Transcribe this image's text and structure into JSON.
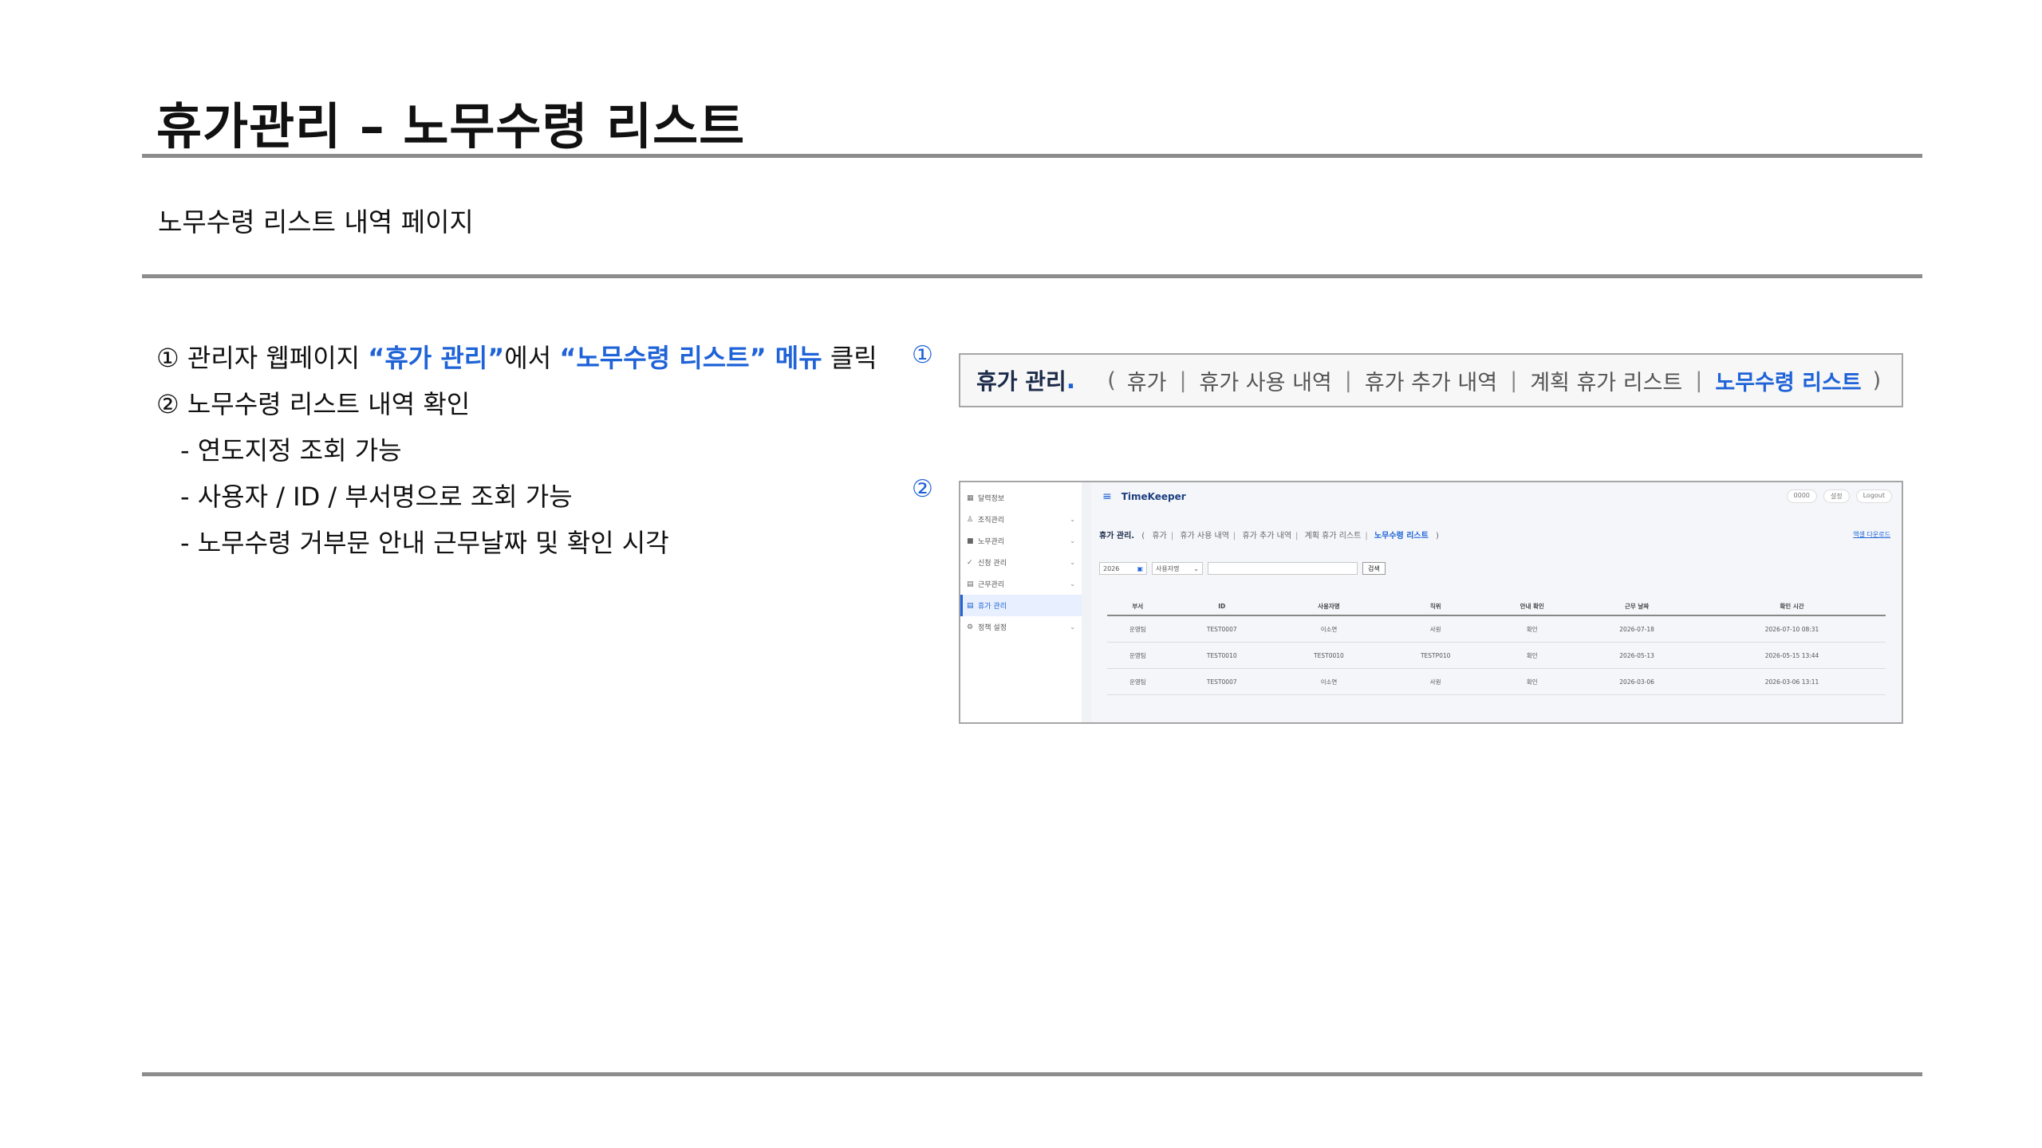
{
  "header": {
    "title": "휴가관리 – 노무수령 리스트",
    "subtitle": "노무수령 리스트 내역 페이지"
  },
  "steps": {
    "step1": {
      "num": "①",
      "pre": "관리자 웹페이지 ",
      "hl1": "“휴가 관리”",
      "mid": "에서 ",
      "hl2": "“노무수령 리스트” 메뉴",
      "post": " 클릭"
    },
    "step2": {
      "num": "②",
      "text": "노무수령 리스트  내역 확인"
    },
    "sub_items": [
      "- 연도지정 조회 가능",
      "- 사용자 / ID / 부서명으로 조회 가능",
      "- 노무수령 거부문 안내 근무날짜 및 확인 시각"
    ]
  },
  "markers": {
    "m1": "①",
    "m2": "②"
  },
  "breadcrumb": {
    "title": "휴가 관리",
    "dot": ".",
    "open": "(",
    "close": ")",
    "items": [
      "휴가",
      "휴가 사용 내역",
      "휴가 추가 내역",
      "계획 휴가 리스트",
      "노무수령 리스트"
    ],
    "separator": "|"
  },
  "app": {
    "brand": "TimeKeeper",
    "menu_icon": "≡",
    "top_right": [
      "0000",
      "설정",
      "Logout"
    ],
    "sidebar": [
      {
        "icon": "chart-icon",
        "glyph": "▦",
        "label": "달력정보",
        "chevron": ""
      },
      {
        "icon": "org-icon",
        "glyph": "♙",
        "label": "조직관리",
        "chevron": "⌄"
      },
      {
        "icon": "folder-icon",
        "glyph": "■",
        "label": "노무관리",
        "chevron": "⌄"
      },
      {
        "icon": "check-icon",
        "glyph": "✓",
        "label": "신청 관리",
        "chevron": "⌄"
      },
      {
        "icon": "calendar-icon",
        "glyph": "▤",
        "label": "근무관리",
        "chevron": "⌄"
      },
      {
        "icon": "calendar-icon",
        "glyph": "▤",
        "label": "휴가 관리",
        "chevron": ""
      },
      {
        "icon": "gear-icon",
        "glyph": "⚙",
        "label": "정책 설정",
        "chevron": "⌄"
      }
    ],
    "crumbs": {
      "title": "휴가 관리.",
      "items": [
        "휴가",
        "휴가 사용 내역",
        "휴가 추가 내역",
        "계획 휴가 리스트",
        "노무수령 리스트"
      ]
    },
    "excel_link": "엑셀 다운로드",
    "filters": {
      "year": "2026",
      "select": "사용자명",
      "search_button": "검색"
    },
    "table": {
      "columns": [
        "부서",
        "ID",
        "사용자명",
        "직위",
        "안내 확인",
        "근무 날짜",
        "확인 시간"
      ],
      "rows": [
        [
          "운영팀",
          "TEST0007",
          "이소연",
          "사원",
          "확인",
          "2026-07-18",
          "2026-07-10 08:31"
        ],
        [
          "운영팀",
          "TEST0010",
          "TEST0010",
          "TESTP010",
          "확인",
          "2026-05-13",
          "2026-05-15 13:44"
        ],
        [
          "운영팀",
          "TEST0007",
          "이소연",
          "사원",
          "확인",
          "2026-03-06",
          "2026-03-06 13:11"
        ]
      ]
    }
  }
}
